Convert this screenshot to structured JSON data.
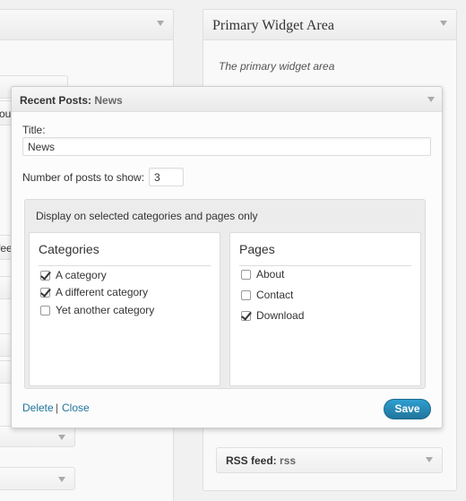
{
  "left_area": {
    "visible_fragments": [
      "ou",
      "fee"
    ]
  },
  "right_area": {
    "title": "Primary Widget Area",
    "description": "The primary widget area"
  },
  "rss_widget": {
    "title": "RSS feed:",
    "subtitle": "rss"
  },
  "dialog": {
    "title": "Recent Posts:",
    "subtitle": "News",
    "title_label": "Title:",
    "title_value": "News",
    "num_posts_label": "Number of posts to show:",
    "num_posts_value": "3",
    "display_caption": "Display on selected categories and pages only",
    "categories": {
      "heading": "Categories",
      "items": [
        {
          "label": "A category",
          "checked": true
        },
        {
          "label": "A different category",
          "checked": true
        },
        {
          "label": "Yet another category",
          "checked": false
        }
      ]
    },
    "pages": {
      "heading": "Pages",
      "items": [
        {
          "label": "About",
          "checked": false
        },
        {
          "label": "Contact",
          "checked": false
        },
        {
          "label": "Download",
          "checked": true
        }
      ]
    },
    "delete_label": "Delete",
    "separator": "|",
    "close_label": "Close",
    "save_label": "Save"
  }
}
